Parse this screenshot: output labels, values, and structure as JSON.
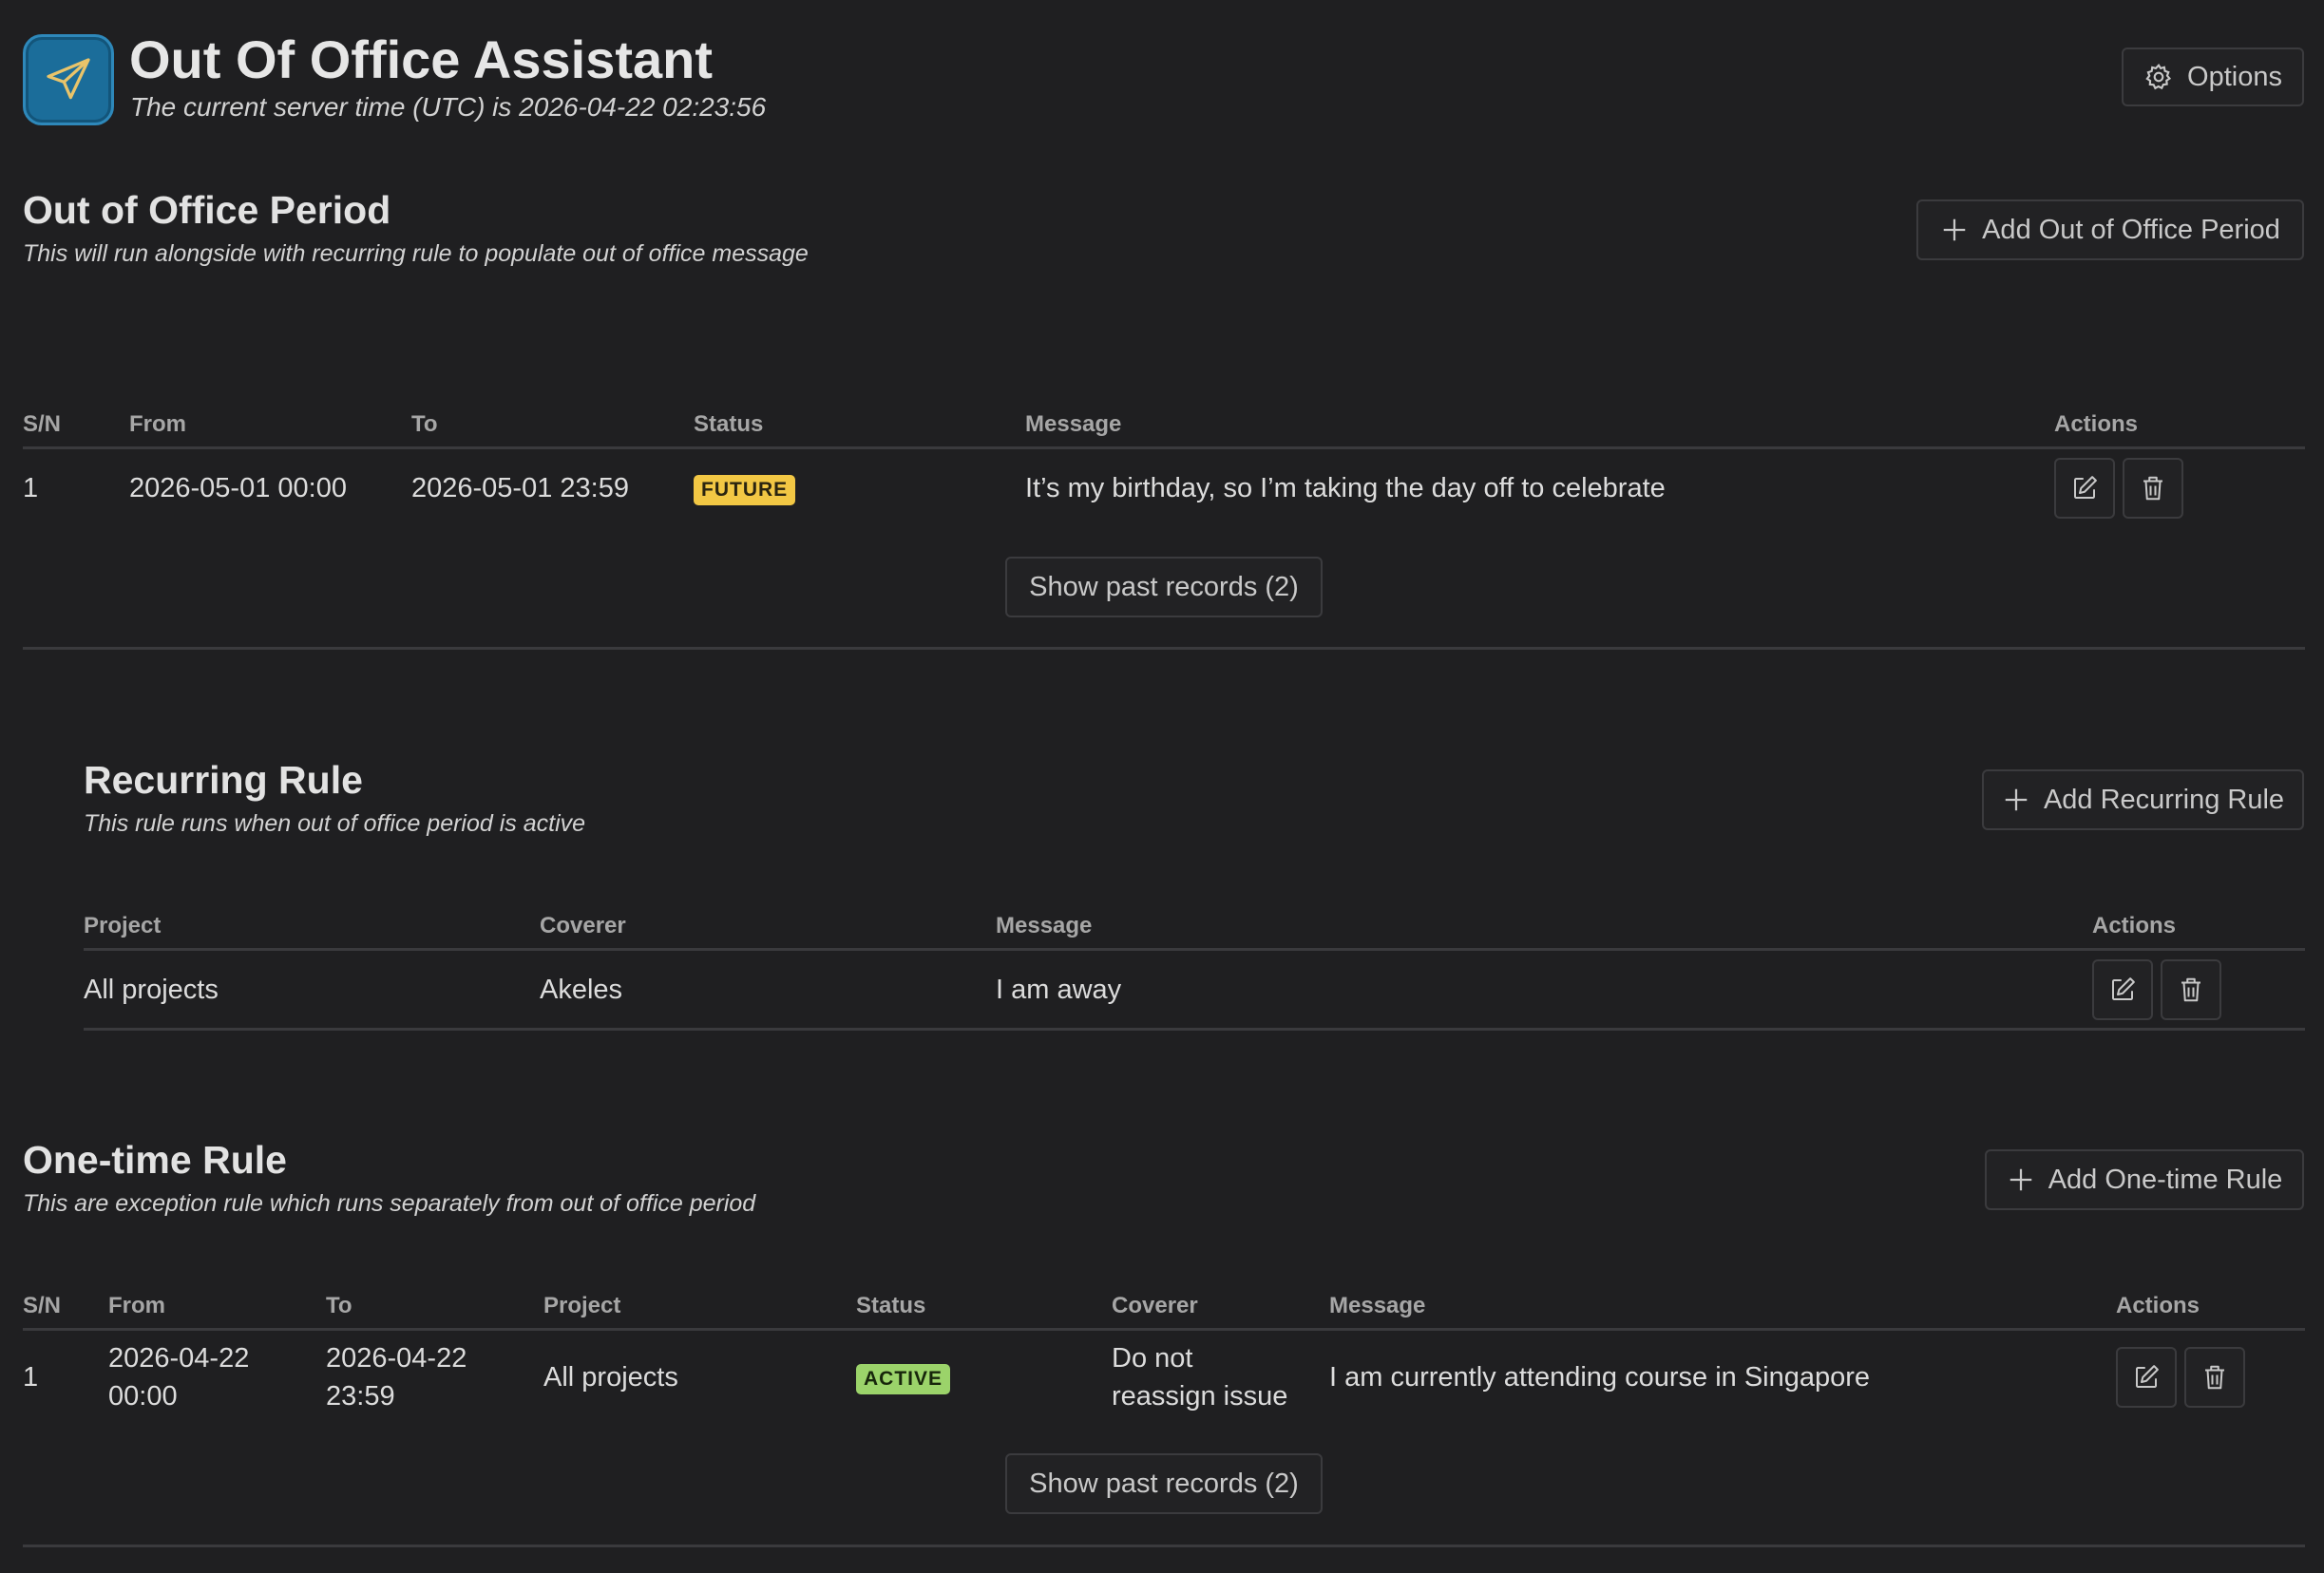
{
  "header": {
    "title": "Out Of Office Assistant",
    "subtitle": "The current server time (UTC) is 2026-04-22 02:23:56",
    "options_label": "Options",
    "logo_icon": "paper-plane-icon"
  },
  "colors": {
    "background": "#1f1f21",
    "future_badge": "#f2c744",
    "active_badge": "#9bd36a",
    "logo": "#1b6d9a"
  },
  "ooo_period": {
    "title": "Out of Office Period",
    "subtitle": "This will run alongside with recurring rule to populate out of office message",
    "add_label": "Add Out of Office Period",
    "columns": [
      "S/N",
      "From",
      "To",
      "Status",
      "Message",
      "Actions"
    ],
    "rows": [
      {
        "sn": "1",
        "from": "2026-05-01 00:00",
        "to": "2026-05-01 23:59",
        "status": "FUTURE",
        "message": "It’s my birthday, so I’m taking the day off to celebrate"
      }
    ],
    "past_label": "Show past records (2)"
  },
  "recurring": {
    "title": "Recurring Rule",
    "subtitle": "This rule runs when out of office period is active",
    "add_label": "Add Recurring Rule",
    "columns": [
      "Project",
      "Coverer",
      "Message",
      "Actions"
    ],
    "rows": [
      {
        "project": "All projects",
        "coverer": "Akeles",
        "message": "I am away"
      }
    ]
  },
  "onetime": {
    "title": "One-time Rule",
    "subtitle": "This are exception rule which runs separately from out of office period",
    "add_label": "Add One-time Rule",
    "columns": [
      "S/N",
      "From",
      "To",
      "Project",
      "Status",
      "Coverer",
      "Message",
      "Actions"
    ],
    "rows": [
      {
        "sn": "1",
        "from_date": "2026-04-22",
        "from_time": "00:00",
        "to_date": "2026-04-22",
        "to_time": "23:59",
        "project": "All projects",
        "status": "ACTIVE",
        "coverer_line1": "Do not",
        "coverer_line2": "reassign issue",
        "message": "I am currently attending course in Singapore"
      }
    ],
    "past_label": "Show past records (2)"
  }
}
